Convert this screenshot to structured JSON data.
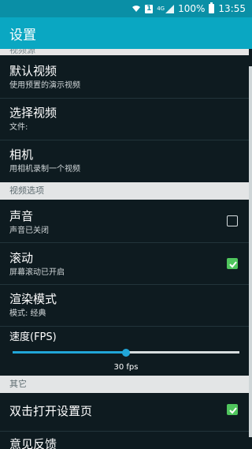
{
  "status_bar": {
    "sim": "1",
    "network_type": "4G",
    "battery_percent": "100%",
    "time": "13:55",
    "icons": [
      "wifi-icon",
      "sim-icon",
      "signal-icon",
      "battery-icon"
    ]
  },
  "app_bar": {
    "title": "设置"
  },
  "list": {
    "cut_category": "视频源",
    "items": [
      {
        "title": "默认视频",
        "summary": "使用预置的演示视频"
      },
      {
        "title": "选择视频",
        "summary": "文件:"
      },
      {
        "title": "相机",
        "summary": "用相机录制一个视频"
      }
    ],
    "category_video_options": "视频选项",
    "options": [
      {
        "title": "声音",
        "summary": "声音已关闭",
        "checked": false
      },
      {
        "title": "滚动",
        "summary": "屏幕滚动已开启",
        "checked": true
      },
      {
        "title": "渲染模式",
        "summary": "模式: 经典"
      }
    ],
    "speed": {
      "label": "速度(FPS)",
      "value_text": "30 fps",
      "fraction": 0.5
    },
    "category_other": "其它",
    "other_items": [
      {
        "title": "双击打开设置页",
        "checked": true
      },
      {
        "title": "意见反馈"
      }
    ]
  },
  "colors": {
    "app_bar": "#0aa7c2",
    "status_bar": "#0a8fa6",
    "background": "#0e1b20",
    "checkbox_checked": "#4fc55d",
    "slider_accent": "#21a6d8"
  }
}
